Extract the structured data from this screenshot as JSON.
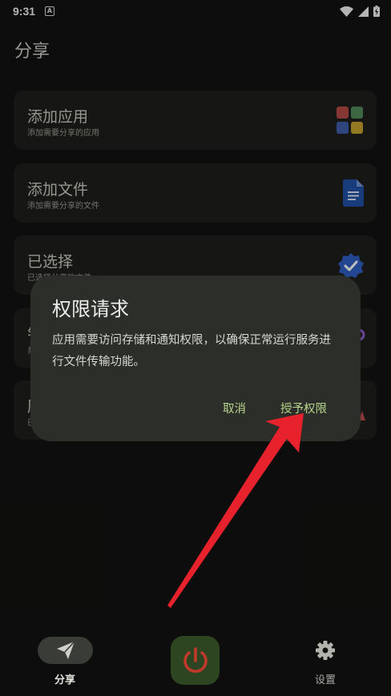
{
  "status_bar": {
    "time": "9:31",
    "notification_letter": "A"
  },
  "page": {
    "title": "分享"
  },
  "cards": [
    {
      "title": "添加应用",
      "subtitle": "添加需要分享的应用"
    },
    {
      "title": "添加文件",
      "subtitle": "添加需要分享的文件"
    },
    {
      "title": "已选择",
      "subtitle": "已选择分享的文件"
    },
    {
      "title": "钅",
      "subtitle": "共"
    },
    {
      "title": "历",
      "subtitle": "已"
    }
  ],
  "dialog": {
    "title": "权限请求",
    "body": "应用需要访问存储和通知权限，以确保正常运行服务进行文件传输功能。",
    "cancel_label": "取消",
    "grant_label": "授予权限"
  },
  "bottom_nav": {
    "share_label": "分享",
    "settings_label": "设置"
  },
  "colors": {
    "background": "#111210",
    "accent_text": "#b7d48a",
    "power_bg": "#2d4520",
    "power_icon": "#c0392b",
    "arrow": "#e8222c"
  }
}
